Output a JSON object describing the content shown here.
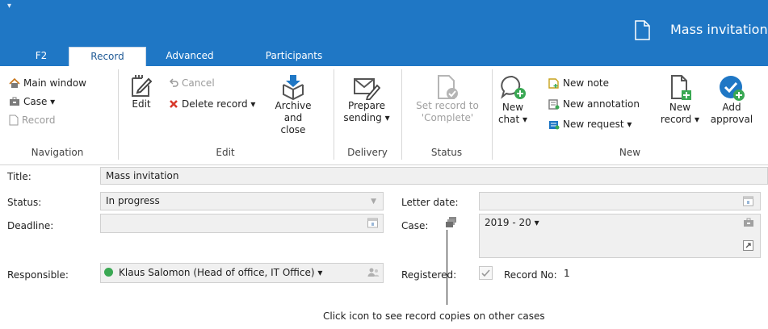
{
  "window": {
    "title": "Mass invitation",
    "quick_access": "▾"
  },
  "tabs": [
    "F2",
    "Record",
    "Advanced",
    "Participants"
  ],
  "ribbon": {
    "navigation": {
      "main_window": "Main window",
      "case": "Case ▾",
      "record": "Record",
      "group": "Navigation"
    },
    "edit": {
      "edit": "Edit",
      "cancel": "Cancel",
      "delete_record": "Delete record ▾",
      "archive_l1": "Archive",
      "archive_l2": "and close",
      "group": "Edit"
    },
    "delivery": {
      "prepare_l1": "Prepare",
      "prepare_l2": "sending ▾",
      "group": "Delivery"
    },
    "status": {
      "set_l1": "Set record to",
      "set_l2": "'Complete'",
      "group": "Status"
    },
    "new": {
      "chat_l1": "New",
      "chat_l2": "chat ▾",
      "note": "New note",
      "annotation": "New annotation",
      "request": "New request ▾",
      "record_l1": "New",
      "record_l2": "record ▾",
      "approval_l1": "Add",
      "approval_l2": "approval",
      "group": "New"
    }
  },
  "form": {
    "title_label": "Title:",
    "title_value": "Mass invitation",
    "status_label": "Status:",
    "status_value": "In progress",
    "deadline_label": "Deadline:",
    "deadline_value": "",
    "responsible_label": "Responsible:",
    "responsible_value": "Klaus Salomon (Head of office, IT Office) ▾",
    "letter_date_label": "Letter date:",
    "letter_date_value": "",
    "case_label": "Case:",
    "case_value": "2019 - 20 ▾",
    "registered_label": "Registered:",
    "registered_checked": true,
    "record_no_label": "Record No:",
    "record_no_value": "1"
  },
  "callout": "Click icon to see record copies on other cases",
  "colors": {
    "titlebar": "#1f77c5",
    "green": "#3aa853",
    "red": "#d83a2c",
    "blue": "#1f77c5",
    "field_bg": "#f0f0f0"
  }
}
